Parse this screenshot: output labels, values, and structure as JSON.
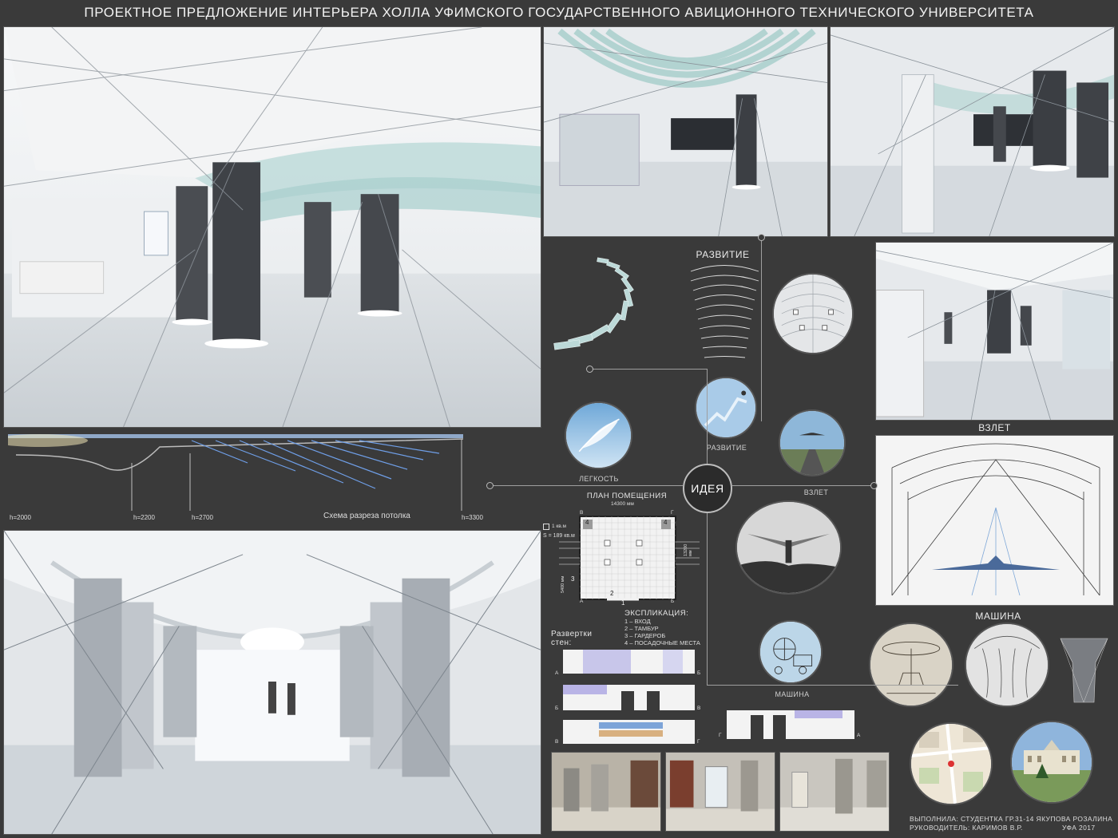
{
  "title": "ПРОЕКТНОЕ ПРЕДЛОЖЕНИЕ ИНТЕРЬЕРА ХОЛЛА УФИМСКОГО ГОСУДАРСТВЕННОГО АВИЦИОННОГО ТЕХНИЧЕСКОГО УНИВЕРСИТЕТА",
  "section": {
    "title": "Схема разреза потолка",
    "heights": [
      "h=2000",
      "h=2200",
      "h=2700",
      "h=3300"
    ]
  },
  "concept": {
    "razvitie_heading": "РАЗВИТИЕ",
    "legkost": "ЛЕГКОСТЬ",
    "razvitie": "РАЗВИТИЕ",
    "vzlet_small": "ВЗЛЕТ",
    "idea": "ИДЕЯ",
    "mashina_small": "МАШИНА",
    "vzlet_heading": "ВЗЛЕТ",
    "mashina_heading": "МАШИНА"
  },
  "plan": {
    "title": "ПЛАН ПОМЕЩЕНИЯ",
    "width_dim": "14300 мм",
    "legend_unit": "1 кв.м",
    "area": "S = 189 кв.м",
    "explication_title": "ЭКСПЛИКАЦИЯ:",
    "explication": [
      "1 – ВХОД",
      "2 – ТАМБУР",
      "3 – ГАРДЕРОБ",
      "4 – ПОСАДОЧНЫЕ МЕСТА"
    ],
    "room_numbers": [
      "4",
      "4",
      "3",
      "3",
      "2",
      "1"
    ],
    "corner_letters": [
      "А",
      "Б",
      "В",
      "Г"
    ],
    "side_dim": "13200 мм",
    "left_dim": "5400 мм"
  },
  "unfold": {
    "title": "Развертки стен:",
    "letters": [
      "А",
      "Б",
      "Б",
      "В",
      "В",
      "Г",
      "Г",
      "А"
    ]
  },
  "credits": {
    "line1": "ВЫПОЛНИЛА: СТУДЕНТКА ГР.31-14 ЯКУПОВА РОЗАЛИНА",
    "line2": "РУКОВОДИТЕЛЬ: КАРИМОВ В.Р.",
    "city": "УФА 2017"
  }
}
